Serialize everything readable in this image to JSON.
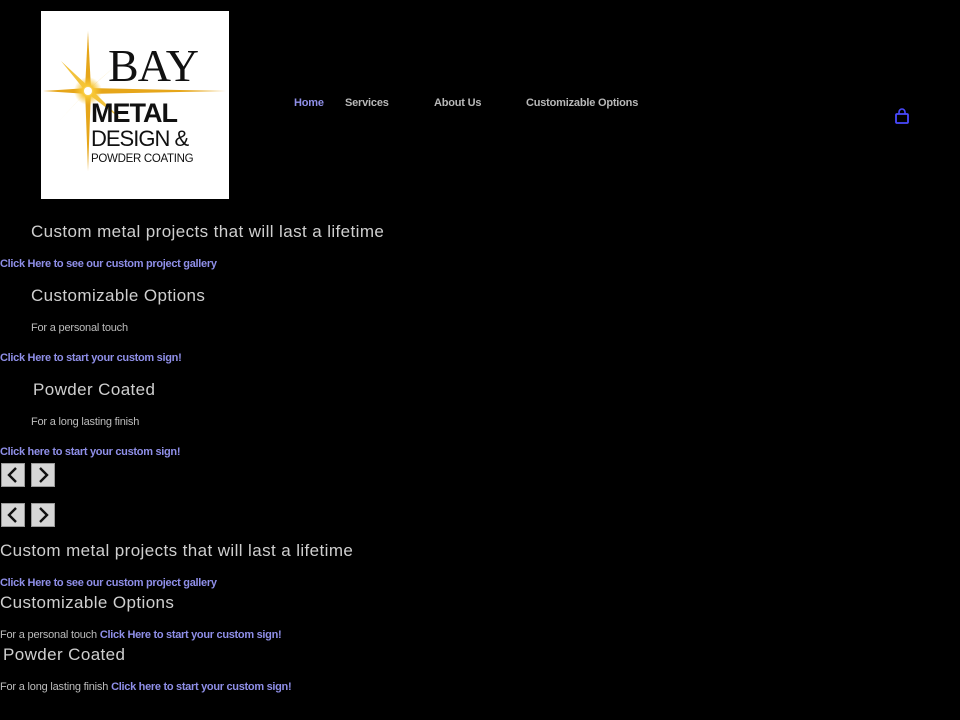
{
  "logo": {
    "line1": "BAY",
    "line2": "METAL",
    "line3": "DESIGN &",
    "line4": "POWDER COATING"
  },
  "nav": {
    "items": [
      {
        "label": "Home"
      },
      {
        "label": "Services"
      },
      {
        "label": "About Us"
      },
      {
        "label": "Customizable Options"
      }
    ]
  },
  "slider": {
    "slides": [
      {
        "heading": "Custom metal projects that will last a lifetime",
        "link": "Click Here to see our custom project gallery"
      },
      {
        "heading": "Customizable Options",
        "subtitle": "For a personal touch",
        "link": "Click Here to start your custom sign!"
      },
      {
        "heading": "Powder Coated",
        "subtitle": "For a long lasting finish",
        "link": "Click here to start your custom sign!"
      }
    ]
  },
  "list": {
    "items": [
      {
        "heading": "Custom metal projects that will last a lifetime",
        "link": "Click Here to see our custom project gallery"
      },
      {
        "heading": "Customizable Options",
        "subtitle": "For a personal touch",
        "link": "Click Here to start your custom sign!"
      },
      {
        "heading": "Powder Coated",
        "subtitle": "For a long lasting finish",
        "link": "Click here to start your custom sign!"
      }
    ]
  },
  "colors": {
    "background": "#000000",
    "link": "#8f8fe8",
    "text": "#cfcfcf"
  }
}
